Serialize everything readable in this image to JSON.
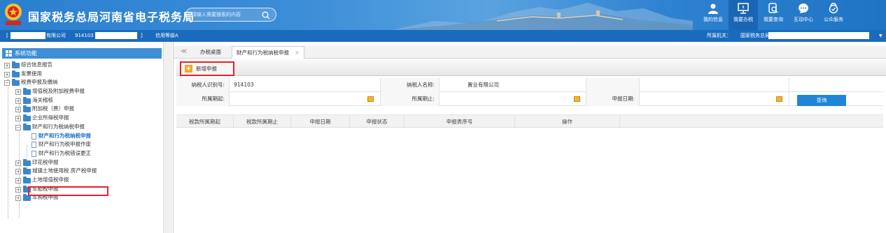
{
  "header": {
    "title": "国家税务总局河南省电子税务局",
    "search_placeholder": "请输入需要搜索的内容",
    "nav": [
      {
        "label": "我的信息",
        "icon": "user-icon"
      },
      {
        "label": "我要办税",
        "icon": "monitor-icon"
      },
      {
        "label": "我要查询",
        "icon": "query-icon"
      },
      {
        "label": "互动中心",
        "icon": "chat-icon"
      },
      {
        "label": "公众服务",
        "icon": "service-icon"
      }
    ]
  },
  "infobar": {
    "bracket_open": "[",
    "company_suffix": "有限公司",
    "tax_id_prefix": "914103",
    "bracket_close": "]",
    "credit_level": "信用等级A",
    "authority_label": "所属机关：",
    "authority_name": "国家税务总局"
  },
  "sidebar": {
    "title": "系统功能",
    "items": [
      {
        "label": "综合信息报告"
      },
      {
        "label": "发票使用"
      },
      {
        "label": "税费申报及缴纳"
      },
      {
        "label": "增值税及附加税费申报"
      },
      {
        "label": "海关稽核"
      },
      {
        "label": "附加税（费）申报"
      },
      {
        "label": "企业所得税申报"
      },
      {
        "label": "财产和行为税纳税申报"
      },
      {
        "label": "财产和行为税纳税申报"
      },
      {
        "label": "财产和行为税申报作废"
      },
      {
        "label": "财产和行为税错误更正"
      },
      {
        "label": "印花税申报"
      },
      {
        "label": "城镇土地使用税 房产税申报"
      },
      {
        "label": "土地增值税申报"
      },
      {
        "label": "车船税申报"
      },
      {
        "label": "车购税申报"
      }
    ]
  },
  "tabs": {
    "collapse": "≪",
    "items": [
      {
        "label": "办税桌面"
      },
      {
        "label": "财产和行为税纳税申报"
      }
    ],
    "close": "×"
  },
  "toolbar": {
    "add_label": "新增申报"
  },
  "form": {
    "taxpayer_id_label": "纳税人识别号:",
    "taxpayer_id_value": "914103",
    "taxpayer_name_label": "纳税人名称:",
    "taxpayer_name_value": "置业有限公司",
    "period_start_label": "所属期起:",
    "period_end_label": "所属期止:",
    "declare_date_label": "申报日期:",
    "query_label": "查询"
  },
  "table": {
    "columns": [
      "税款所属期起",
      "税款所属期止",
      "申报日期",
      "申报状态",
      "申报表序号",
      "操作"
    ]
  }
}
